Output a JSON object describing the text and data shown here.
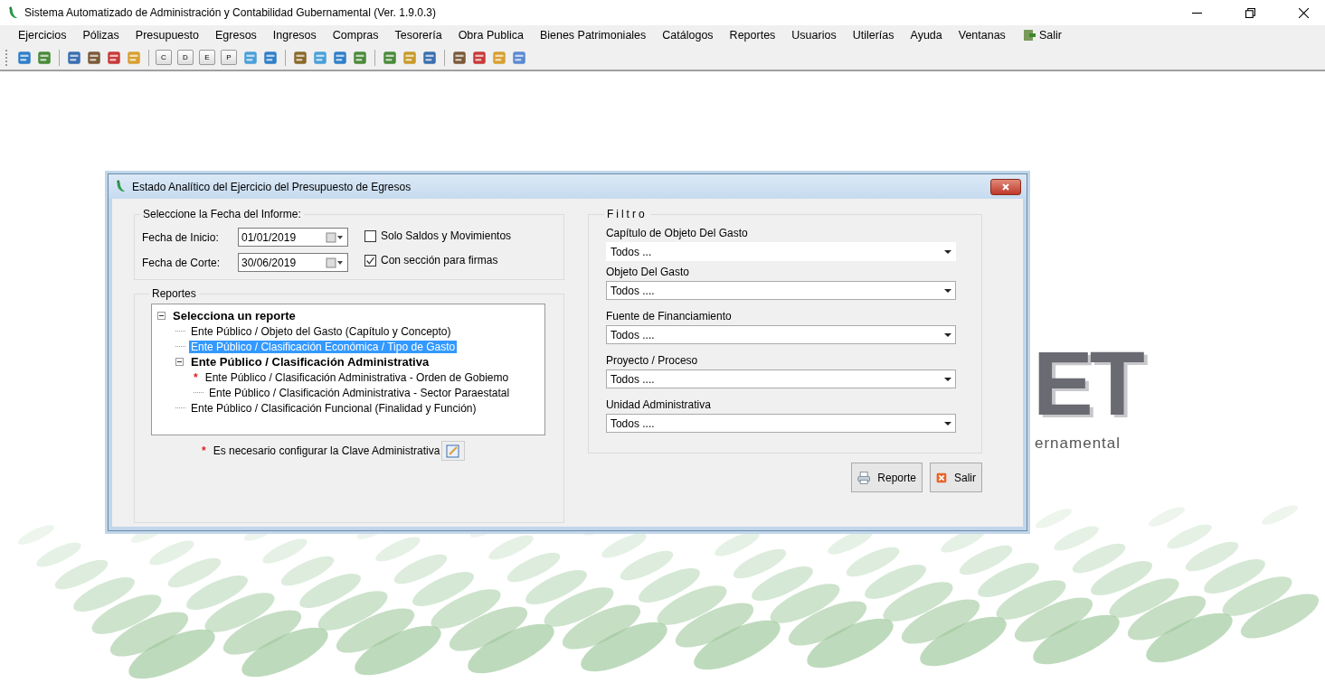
{
  "window": {
    "title": "Sistema Automatizado de Administración y Contabilidad Gubernamental  (Ver. 1.9.0.3)"
  },
  "menu": [
    {
      "label": "Ejercicios",
      "kind": "text"
    },
    {
      "label": "Pólizas",
      "kind": "text"
    },
    {
      "label": "Presupuesto",
      "kind": "text"
    },
    {
      "label": "Egresos",
      "kind": "text"
    },
    {
      "label": "Ingresos",
      "kind": "text"
    },
    {
      "label": "Compras",
      "kind": "text"
    },
    {
      "label": "Tesorería",
      "kind": "text"
    },
    {
      "label": "Obra Publica",
      "kind": "text"
    },
    {
      "label": "Bienes Patrimoniales",
      "kind": "text"
    },
    {
      "label": "Catálogos",
      "kind": "text"
    },
    {
      "label": "Reportes",
      "kind": "text"
    },
    {
      "label": "Usuarios",
      "kind": "text"
    },
    {
      "label": "Utilerías",
      "kind": "text"
    },
    {
      "label": "Ayuda",
      "kind": "text"
    },
    {
      "label": "Ventanas",
      "kind": "text"
    },
    {
      "label": "Salir",
      "kind": "exit"
    }
  ],
  "toolbar": [
    [
      {
        "kind": "icon"
      },
      {
        "kind": "icon"
      }
    ],
    [
      {
        "kind": "icon"
      },
      {
        "kind": "icon"
      },
      {
        "kind": "icon"
      },
      {
        "kind": "icon"
      }
    ],
    [
      {
        "kind": "key",
        "label": "C"
      },
      {
        "kind": "key",
        "label": "D"
      },
      {
        "kind": "key",
        "label": "E"
      },
      {
        "kind": "key",
        "label": "P"
      },
      {
        "kind": "icon"
      },
      {
        "kind": "icon"
      }
    ],
    [
      {
        "kind": "icon"
      },
      {
        "kind": "icon"
      },
      {
        "kind": "icon"
      },
      {
        "kind": "icon"
      }
    ],
    [
      {
        "kind": "icon"
      },
      {
        "kind": "icon"
      },
      {
        "kind": "icon"
      }
    ],
    [
      {
        "kind": "icon"
      },
      {
        "kind": "icon"
      },
      {
        "kind": "icon"
      },
      {
        "kind": "icon"
      }
    ]
  ],
  "logo": {
    "letters": "ET",
    "subtitle": "ernamental"
  },
  "dialog": {
    "title": "Estado Analítico del Ejercicio del Presupuesto de Egresos",
    "date_group": {
      "title": "Seleccione la Fecha del Informe:",
      "fields": [
        {
          "label": "Fecha de Inicio:",
          "value": "01/01/2019"
        },
        {
          "label": "Fecha de Corte:",
          "value": "30/06/2019"
        }
      ],
      "checkboxes": [
        {
          "label": "Solo Saldos y Movimientos",
          "checked": false
        },
        {
          "label": "Con sección para firmas",
          "checked": true
        }
      ]
    },
    "reports": {
      "title": "Reportes",
      "tree": [
        {
          "label": "Selecciona un reporte",
          "bold": true,
          "expanded": true,
          "selected": false,
          "children": [
            {
              "label": "Ente Público /  Objeto del Gasto (Capítulo y Concepto)",
              "bold": false,
              "selected": false
            },
            {
              "label": "Ente Público /  Clasificación Económica / Tipo de Gasto",
              "bold": false,
              "selected": true
            },
            {
              "label": "Ente Público /  Clasificación Administrativa",
              "bold": true,
              "expanded": true,
              "selected": false,
              "children": [
                {
                  "label": "Ente Público /  Clasificación Administrativa - Orden de Gobiemo",
                  "bold": false,
                  "selected": false,
                  "marker": "*"
                },
                {
                  "label": "Ente Público /  Clasificación Administrativa - Sector Paraestatal",
                  "bold": false,
                  "selected": false
                }
              ]
            },
            {
              "label": "Ente Público /  Clasificación Funcional (Finalidad y Función)",
              "bold": false,
              "selected": false
            }
          ]
        }
      ],
      "note": {
        "marker": "*",
        "text": "Es necesario configurar la Clave Administrativa"
      }
    },
    "filter": {
      "title": "Filtro",
      "fields": [
        {
          "label": "Capítulo de Objeto Del Gasto",
          "value": "Todos  ...",
          "kind": "flat"
        },
        {
          "label": "Objeto Del Gasto",
          "value": "Todos ....",
          "kind": "boxed"
        },
        {
          "label": "Fuente de Financiamiento",
          "value": "Todos ....",
          "kind": "boxed"
        },
        {
          "label": "Proyecto / Proceso",
          "value": "Todos ....",
          "kind": "boxed"
        },
        {
          "label": "Unidad Administrativa",
          "value": "Todos ....",
          "kind": "boxed"
        }
      ]
    },
    "buttons": [
      {
        "label": "Reporte",
        "kind": "print"
      },
      {
        "label": "Salir",
        "kind": "exit"
      }
    ]
  }
}
